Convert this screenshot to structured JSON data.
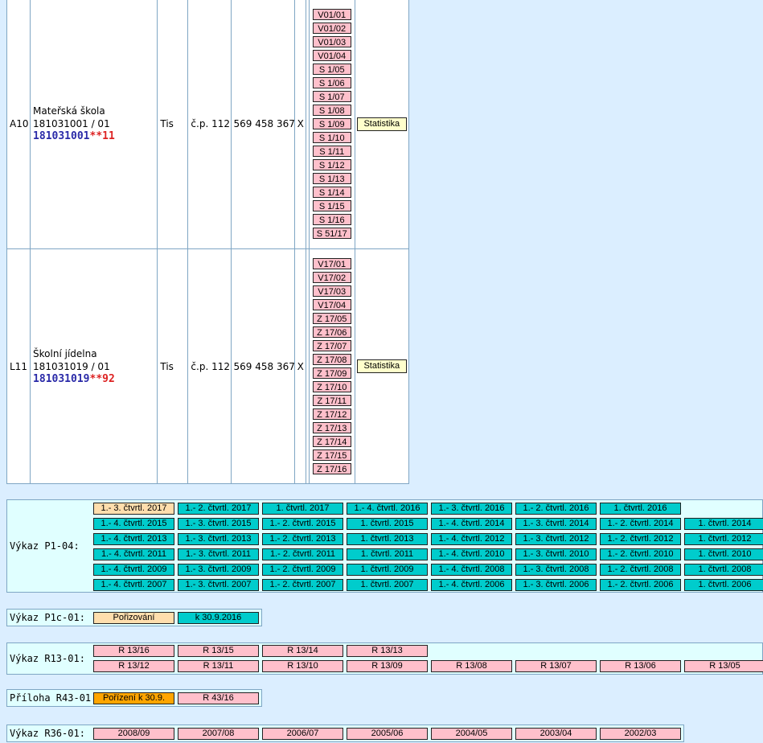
{
  "rows": [
    {
      "id": "A10",
      "name": "Mateřská škola",
      "code": "181031001 / 01",
      "izo": "181031001",
      "izo_suffix": "**11",
      "town": "Tis",
      "address": "č.p. 112",
      "phone": "569 458 367",
      "mark": "X",
      "reports": [
        "V01/01",
        "V01/02",
        "V01/03",
        "V01/04",
        "S 1/05",
        "S 1/06",
        "S 1/07",
        "S 1/08",
        "S 1/09",
        "S 1/10",
        "S 1/11",
        "S 1/12",
        "S 1/13",
        "S 1/14",
        "S 1/15",
        "S 1/16",
        "S 51/17"
      ],
      "stat_label": "Statistika"
    },
    {
      "id": "L11",
      "name": "Školní jídelna",
      "code": "181031019 / 01",
      "izo": "181031019",
      "izo_suffix": "**92",
      "town": "Tis",
      "address": "č.p. 112",
      "phone": "569 458 367",
      "mark": "X",
      "reports": [
        "V17/01",
        "V17/02",
        "V17/03",
        "V17/04",
        "Z 17/05",
        "Z 17/06",
        "Z 17/07",
        "Z 17/08",
        "Z 17/09",
        "Z 17/10",
        "Z 17/11",
        "Z 17/12",
        "Z 17/13",
        "Z 17/14",
        "Z 17/15",
        "Z 17/16"
      ],
      "stat_label": "Statistika"
    }
  ],
  "p104": {
    "label": "Výkaz P1-04:",
    "rows": [
      [
        {
          "t": "1.- 3. čtvrtl. 2017",
          "c": "beige"
        },
        {
          "t": "1.- 2. čtvrtl. 2017",
          "c": "teal"
        },
        {
          "t": "1. čtvrtl. 2017",
          "c": "teal"
        },
        {
          "t": "1.- 4. čtvrtl. 2016",
          "c": "teal"
        },
        {
          "t": "1.- 3. čtvrtl. 2016",
          "c": "teal"
        },
        {
          "t": "1.- 2. čtvrtl. 2016",
          "c": "teal"
        },
        {
          "t": "1. čtvrtl. 2016",
          "c": "teal"
        }
      ],
      [
        {
          "t": "1.- 4. čtvrtl. 2015",
          "c": "teal"
        },
        {
          "t": "1.- 3. čtvrtl. 2015",
          "c": "teal"
        },
        {
          "t": "1.- 2. čtvrtl. 2015",
          "c": "teal"
        },
        {
          "t": "1. čtvrtl. 2015",
          "c": "teal"
        },
        {
          "t": "1.- 4. čtvrtl. 2014",
          "c": "teal"
        },
        {
          "t": "1.- 3. čtvrtl. 2014",
          "c": "teal"
        },
        {
          "t": "1.- 2. čtvrtl. 2014",
          "c": "teal"
        },
        {
          "t": "1. čtvrtl. 2014",
          "c": "teal"
        }
      ],
      [
        {
          "t": "1.- 4. čtvrtl. 2013",
          "c": "teal"
        },
        {
          "t": "1.- 3. čtvrtl. 2013",
          "c": "teal"
        },
        {
          "t": "1.- 2. čtvrtl. 2013",
          "c": "teal"
        },
        {
          "t": "1. čtvrtl. 2013",
          "c": "teal"
        },
        {
          "t": "1.- 4. čtvrtl. 2012",
          "c": "teal"
        },
        {
          "t": "1.- 3. čtvrtl. 2012",
          "c": "teal"
        },
        {
          "t": "1.- 2. čtvrtl. 2012",
          "c": "teal"
        },
        {
          "t": "1. čtvrtl. 2012",
          "c": "teal"
        }
      ],
      [
        {
          "t": "1.- 4. čtvrtl. 2011",
          "c": "teal"
        },
        {
          "t": "1.- 3. čtvrtl. 2011",
          "c": "teal"
        },
        {
          "t": "1.- 2. čtvrtl. 2011",
          "c": "teal"
        },
        {
          "t": "1. čtvrtl. 2011",
          "c": "teal"
        },
        {
          "t": "1.- 4. čtvrtl. 2010",
          "c": "teal"
        },
        {
          "t": "1.- 3. čtvrtl. 2010",
          "c": "teal"
        },
        {
          "t": "1.- 2. čtvrtl. 2010",
          "c": "teal"
        },
        {
          "t": "1. čtvrtl. 2010",
          "c": "teal"
        }
      ],
      [
        {
          "t": "1.- 4. čtvrtl. 2009",
          "c": "teal"
        },
        {
          "t": "1.- 3. čtvrtl. 2009",
          "c": "teal"
        },
        {
          "t": "1.- 2. čtvrtl. 2009",
          "c": "teal"
        },
        {
          "t": "1. čtvrtl. 2009",
          "c": "teal"
        },
        {
          "t": "1.- 4. čtvrtl. 2008",
          "c": "teal"
        },
        {
          "t": "1.- 3. čtvrtl. 2008",
          "c": "teal"
        },
        {
          "t": "1.- 2. čtvrtl. 2008",
          "c": "teal"
        },
        {
          "t": "1. čtvrtl. 2008",
          "c": "teal"
        }
      ],
      [
        {
          "t": "1.- 4. čtvrtl. 2007",
          "c": "teal"
        },
        {
          "t": "1.- 3. čtvrtl. 2007",
          "c": "teal"
        },
        {
          "t": "1.- 2. čtvrtl. 2007",
          "c": "teal"
        },
        {
          "t": "1. čtvrtl. 2007",
          "c": "teal"
        },
        {
          "t": "1.- 4. čtvrtl. 2006",
          "c": "teal"
        },
        {
          "t": "1.- 3. čtvrtl. 2006",
          "c": "teal"
        },
        {
          "t": "1.- 2. čtvrtl. 2006",
          "c": "teal"
        },
        {
          "t": "1. čtvrtl. 2006",
          "c": "teal"
        }
      ]
    ]
  },
  "p1c01": {
    "label": "Výkaz P1c-01:",
    "rows": [
      [
        {
          "t": "Pořizování",
          "c": "beige"
        },
        {
          "t": "k 30.9.2016",
          "c": "teal"
        }
      ]
    ]
  },
  "r1301": {
    "label": "Výkaz R13-01:",
    "rows": [
      [
        {
          "t": "R 13/16",
          "c": "pink"
        },
        {
          "t": "R 13/15",
          "c": "pink"
        },
        {
          "t": "R 13/14",
          "c": "pink"
        },
        {
          "t": "R 13/13",
          "c": "pink"
        }
      ],
      [
        {
          "t": "R 13/12",
          "c": "pink"
        },
        {
          "t": "R 13/11",
          "c": "pink"
        },
        {
          "t": "R 13/10",
          "c": "pink"
        },
        {
          "t": "R 13/09",
          "c": "pink"
        },
        {
          "t": "R 13/08",
          "c": "pink"
        },
        {
          "t": "R 13/07",
          "c": "pink"
        },
        {
          "t": "R 13/06",
          "c": "pink"
        },
        {
          "t": "R 13/05",
          "c": "pink"
        }
      ]
    ]
  },
  "r4301": {
    "label": "Příloha R43-01:",
    "rows": [
      [
        {
          "t": "Pořízení k 30.9.",
          "c": "orange"
        },
        {
          "t": "R 43/16",
          "c": "pink"
        }
      ]
    ]
  },
  "r3601": {
    "label": "Výkaz R36-01:",
    "rows": [
      [
        {
          "t": "2008/09",
          "c": "pink"
        },
        {
          "t": "2007/08",
          "c": "pink"
        },
        {
          "t": "2006/07",
          "c": "pink"
        },
        {
          "t": "2005/06",
          "c": "pink"
        },
        {
          "t": "2004/05",
          "c": "pink"
        },
        {
          "t": "2003/04",
          "c": "pink"
        },
        {
          "t": "2002/03",
          "c": "pink"
        }
      ]
    ]
  },
  "colors": {
    "teal": "#00cccc",
    "pink": "#ffc0cb",
    "beige": "#ffdead",
    "orange": "#ffa500",
    "background": "#dbeeff"
  }
}
